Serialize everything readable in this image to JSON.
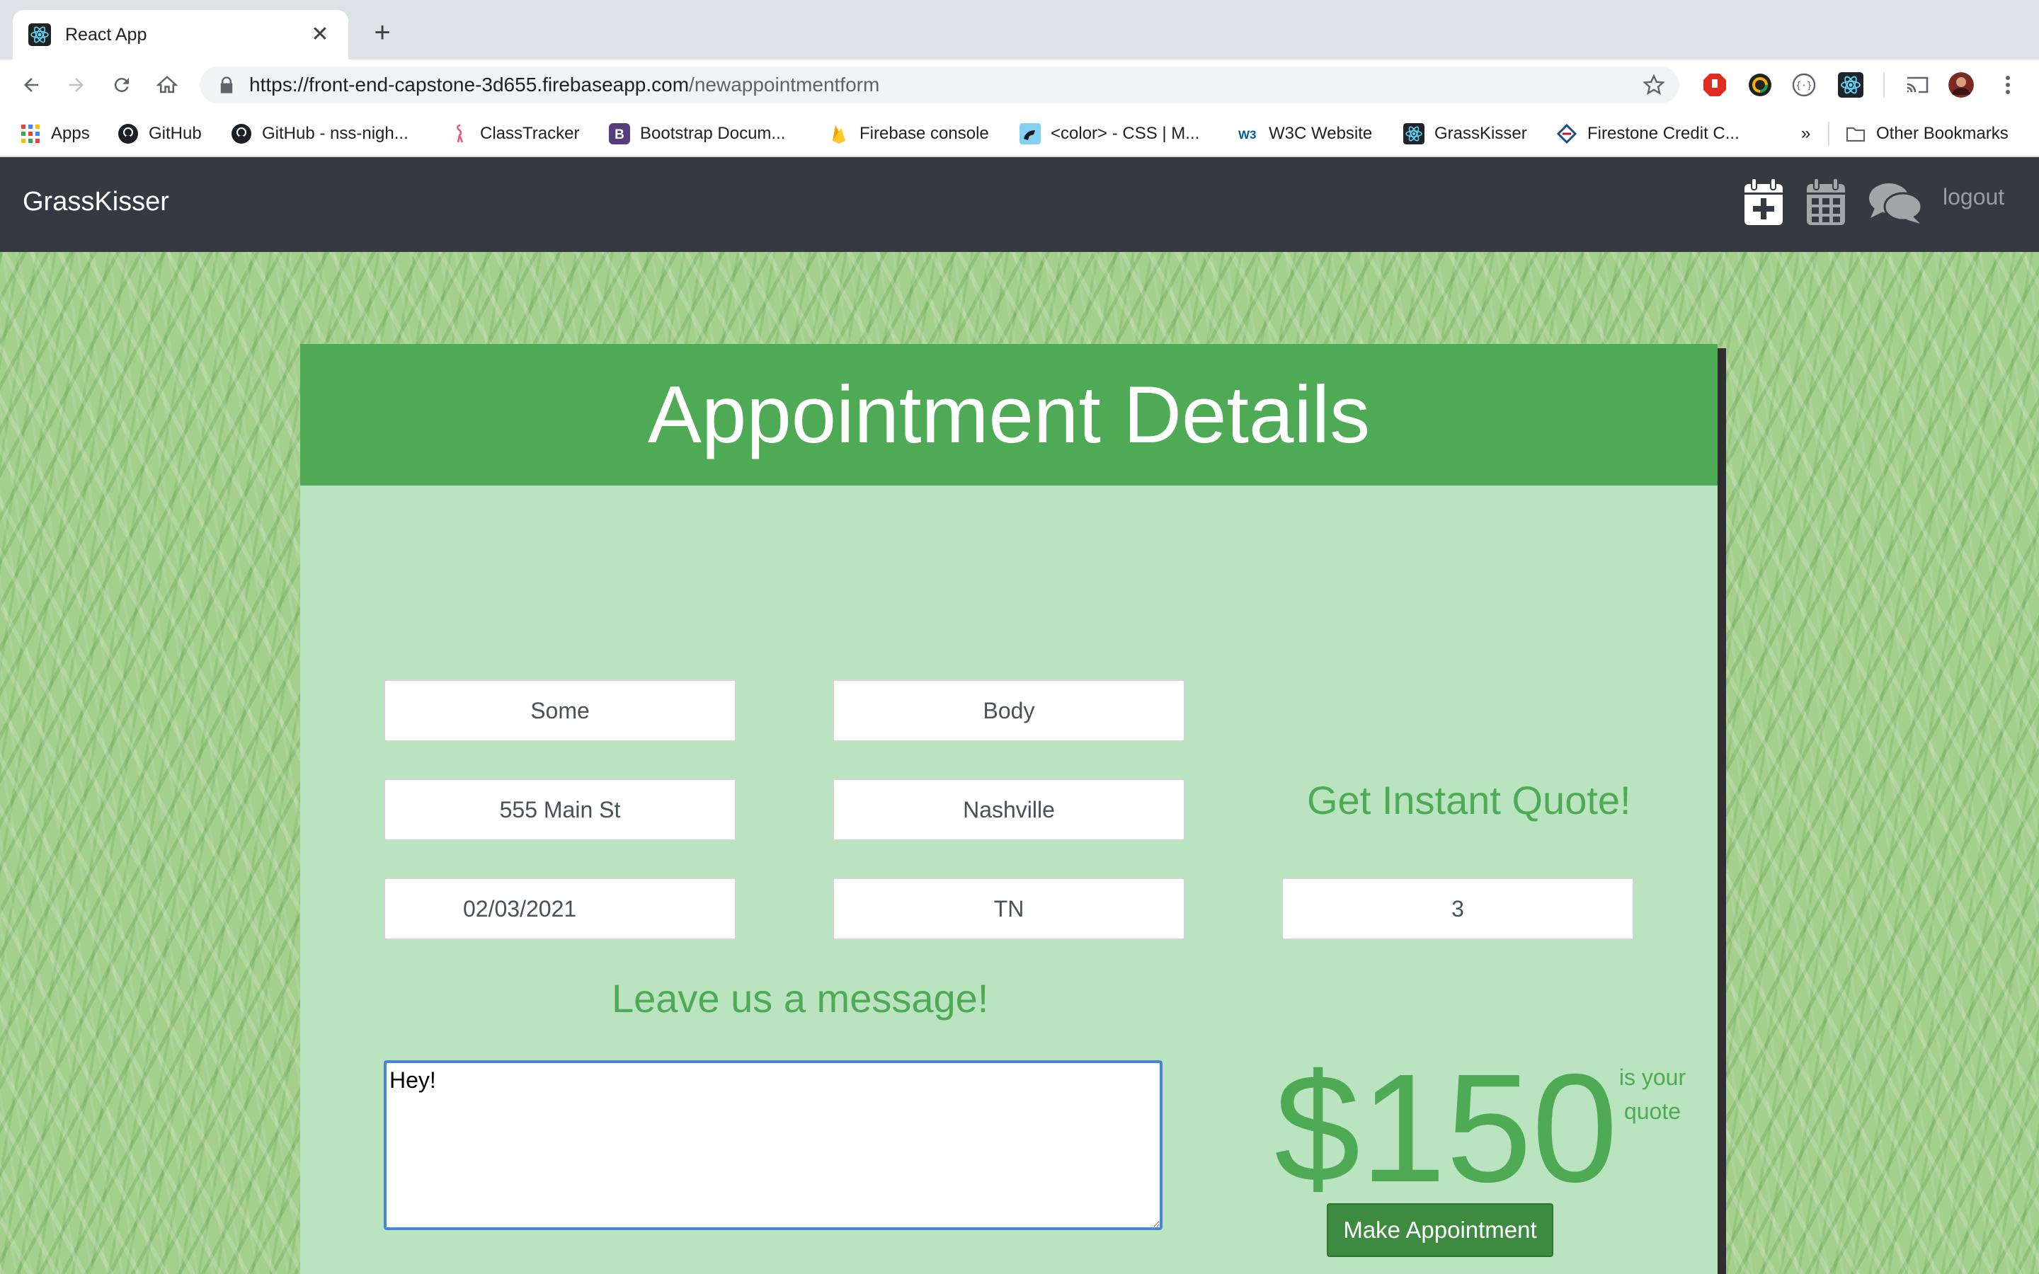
{
  "browser": {
    "tab_title": "React App",
    "tab_close": "✕",
    "new_tab": "+",
    "url_main": "https://front-end-capstone-3d655.firebaseapp.com",
    "url_path": "/newappointmentform",
    "bookmarks": [
      "Apps",
      "GitHub",
      "GitHub - nss-nigh...",
      "ClassTracker",
      "Bootstrap Docum...",
      "Firebase console",
      "<color> - CSS | M...",
      "W3C Website",
      "GrassKisser",
      "Firestone Credit C..."
    ],
    "bookmarks_overflow": "»",
    "other_bookmarks": "Other Bookmarks"
  },
  "navbar": {
    "brand": "GrassKisser",
    "logout": "logout"
  },
  "form": {
    "title": "Appointment Details",
    "first_name": "Some",
    "last_name": "Body",
    "street": "555 Main St",
    "city": "Nashville",
    "date": "02/03/2021",
    "state": "TN",
    "quote_label": "Get Instant Quote!",
    "quote_input": "3",
    "message_label": "Leave us a message!",
    "message": "Hey!",
    "price": "$150",
    "price_note_line1": "is your",
    "price_note_line2": "quote",
    "submit_label": "Make Appointment"
  },
  "colors": {
    "header_green": "#4faa55",
    "card_bg": "#bae4c0",
    "navbar_bg": "#343a40",
    "button_green": "#3d8b40"
  }
}
